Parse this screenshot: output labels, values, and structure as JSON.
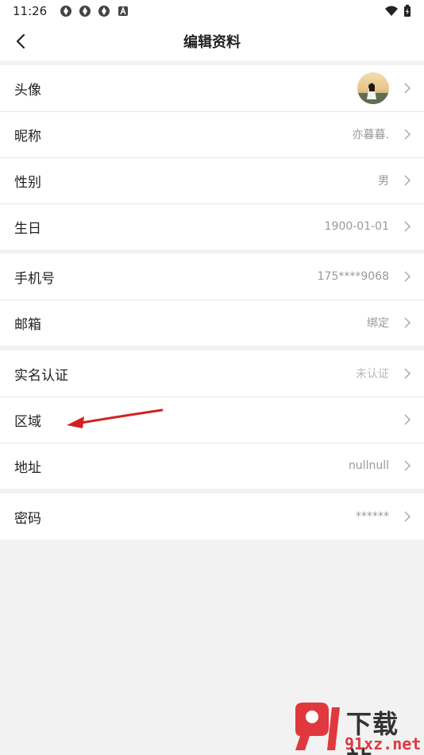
{
  "status_bar": {
    "time": "11:26"
  },
  "header": {
    "title": "编辑资料"
  },
  "groups": [
    {
      "rows": [
        {
          "label": "头像",
          "value": ""
        },
        {
          "label": "昵称",
          "value": "亦暮暮."
        },
        {
          "label": "性别",
          "value": "男"
        },
        {
          "label": "生日",
          "value": "1900-01-01"
        }
      ]
    },
    {
      "rows": [
        {
          "label": "手机号",
          "value": "175****9068"
        },
        {
          "label": "邮箱",
          "value": "绑定"
        }
      ]
    },
    {
      "rows": [
        {
          "label": "实名认证",
          "value": "未认证"
        },
        {
          "label": "区域",
          "value": ""
        },
        {
          "label": "地址",
          "value": "nullnull"
        }
      ]
    },
    {
      "rows": [
        {
          "label": "密码",
          "value": "******"
        }
      ]
    }
  ],
  "watermark": {
    "brand": "下载站",
    "url": "91xz.net"
  },
  "colors": {
    "annotation_arrow": "#d42020",
    "watermark_red": "#e0383e"
  }
}
